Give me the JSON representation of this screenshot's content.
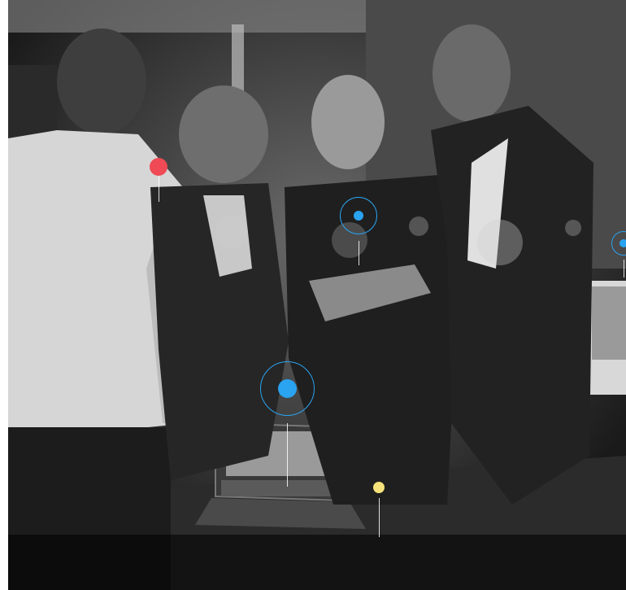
{
  "image": {
    "description_name": "business-team-photo",
    "style": "black-and-white"
  },
  "markers": [
    {
      "name": "red-marker-dot",
      "color": "#ef4a55",
      "ringed": false
    },
    {
      "name": "blue-marker-dot-tablet",
      "color": "#2aa3f0",
      "ringed": true
    },
    {
      "name": "blue-marker-dot-large",
      "color": "#2aa3f0",
      "ringed": true
    },
    {
      "name": "yellow-marker-dot",
      "color": "#f5e27a",
      "ringed": false
    },
    {
      "name": "blue-marker-dot-edge",
      "color": "#2aa3f0",
      "ringed": true
    }
  ],
  "colors": {
    "accent_blue": "#2aa3f0",
    "accent_red": "#ef4a55",
    "accent_yellow": "#f5e27a"
  }
}
